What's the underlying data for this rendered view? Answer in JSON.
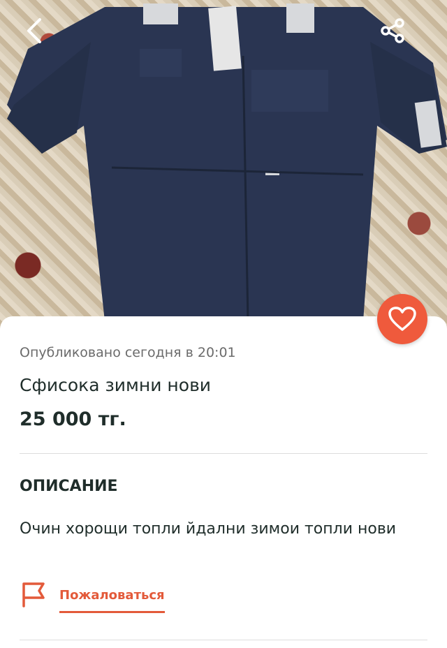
{
  "listing": {
    "published": "Опубликовано сегодня в 20:01",
    "title": "Сфисока зимни нови",
    "price": "25 000 тг."
  },
  "description": {
    "heading": "ОПИСАНИЕ",
    "text": "Очин хорощи топли йдални зимои топли нови"
  },
  "actions": {
    "report_label": "Пожаловаться"
  },
  "icons": {
    "back": "chevron-left-icon",
    "share": "share-icon",
    "favorite": "heart-icon",
    "report": "flag-icon"
  },
  "colors": {
    "accent": "#ef5a3c",
    "text": "#1f2d2a",
    "muted": "#6b6b6b",
    "coverall": "#2a3552"
  }
}
